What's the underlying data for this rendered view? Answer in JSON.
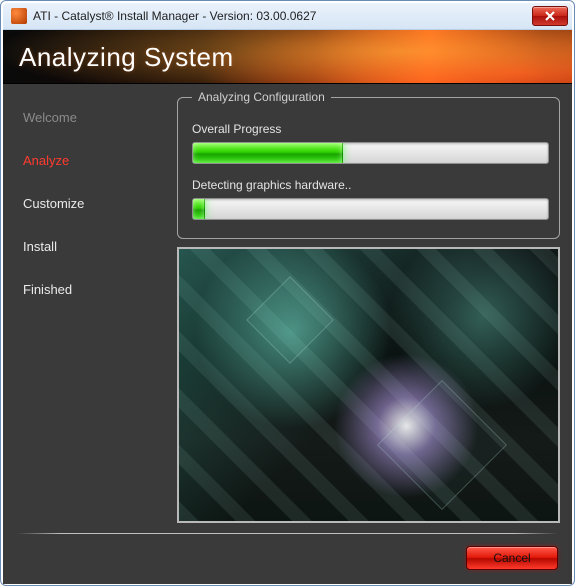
{
  "window": {
    "title": "ATI - Catalyst® Install Manager - Version: 03.00.0627"
  },
  "banner": {
    "heading": "Analyzing System"
  },
  "sidebar": {
    "steps": [
      {
        "label": "Welcome",
        "state": "dim"
      },
      {
        "label": "Analyze",
        "state": "active"
      },
      {
        "label": "Customize",
        "state": "norm"
      },
      {
        "label": "Install",
        "state": "norm"
      },
      {
        "label": "Finished",
        "state": "norm"
      }
    ]
  },
  "config": {
    "legend": "Analyzing Configuration",
    "overall_label": "Overall Progress",
    "overall_percent": 42,
    "task_label": "Detecting graphics hardware..",
    "task_percent": 3
  },
  "footer": {
    "cancel_label": "Cancel"
  },
  "colors": {
    "accent": "#ff3b2f"
  }
}
